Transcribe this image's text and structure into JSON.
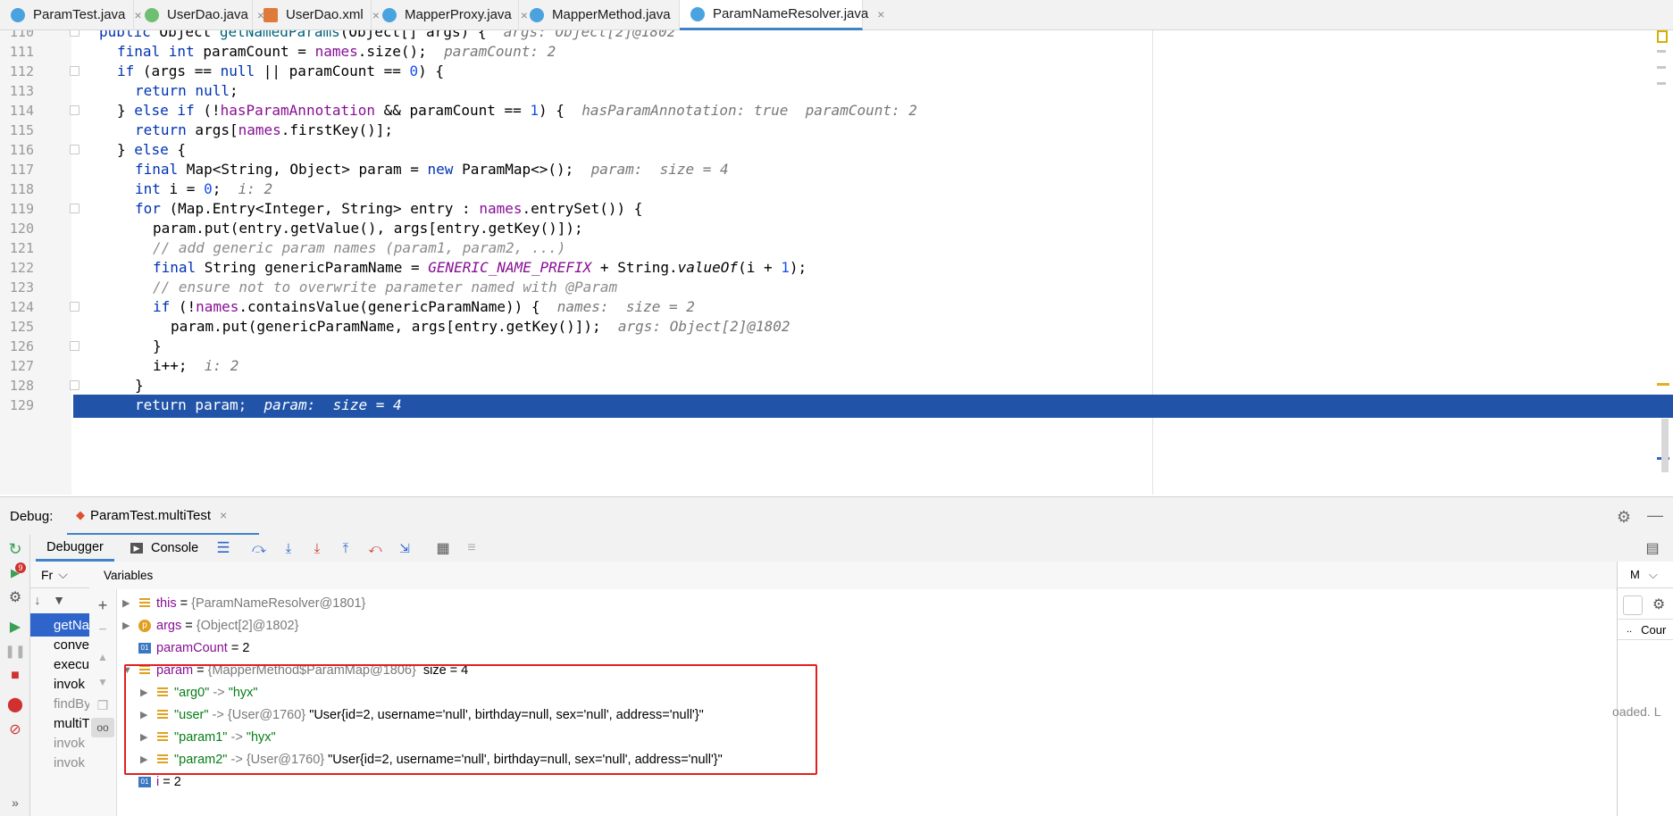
{
  "tabs": [
    {
      "label": "ParamTest.java",
      "icon_color": "#4aa3df",
      "active": false
    },
    {
      "label": "UserDao.java",
      "icon_color": "#6fbf73",
      "active": false
    },
    {
      "label": "UserDao.xml",
      "icon_color": "#e07a3a",
      "active": false
    },
    {
      "label": "MapperProxy.java",
      "icon_color": "#4aa3df",
      "active": false
    },
    {
      "label": "MapperMethod.java",
      "icon_color": "#4aa3df",
      "active": false
    },
    {
      "label": "ParamNameResolver.java",
      "icon_color": "#4aa3df",
      "active": true
    }
  ],
  "editor": {
    "lines": [
      {
        "n": "110"
      },
      {
        "n": "111"
      },
      {
        "n": "112"
      },
      {
        "n": "113"
      },
      {
        "n": "114"
      },
      {
        "n": "115"
      },
      {
        "n": "116"
      },
      {
        "n": "117"
      },
      {
        "n": "118"
      },
      {
        "n": "119"
      },
      {
        "n": "120"
      },
      {
        "n": "121"
      },
      {
        "n": "122"
      },
      {
        "n": "123"
      },
      {
        "n": "124"
      },
      {
        "n": "125"
      },
      {
        "n": "126"
      },
      {
        "n": "127"
      },
      {
        "n": "128"
      },
      {
        "n": "129"
      }
    ],
    "code": {
      "l110": {
        "kw1": "public",
        "t1": " Object ",
        "fn": "getNamedParams",
        "t2": "(Object[] args) {",
        "hint": "args: Object[2]@1802"
      },
      "l111": {
        "kw1": "final int",
        "t1": " paramCount = ",
        "fld": "names",
        "t2": ".size();",
        "hint": "paramCount: 2"
      },
      "l112": {
        "kw1": "if",
        "t1": " (args == ",
        "kw2": "null",
        "t2": " || paramCount == ",
        "num": "0",
        "t3": ") {"
      },
      "l113": {
        "kw1": "return null",
        "t1": ";"
      },
      "l114": {
        "t0": "} ",
        "kw1": "else if",
        "t1": " (!",
        "fld": "hasParamAnnotation",
        "t2": " && paramCount == ",
        "num": "1",
        "t3": ") {",
        "hint": "hasParamAnnotation: true  paramCount: 2"
      },
      "l115": {
        "kw1": "return",
        "t1": " args[",
        "fld": "names",
        "t2": ".firstKey()];"
      },
      "l116": {
        "t0": "} ",
        "kw1": "else",
        "t1": " {"
      },
      "l117": {
        "kw1": "final",
        "t1": " Map<String, Object> param = ",
        "kw2": "new",
        "t2": " ParamMap<>();",
        "hint": "param:  size = 4"
      },
      "l118": {
        "kw1": "int",
        "t1": " i = ",
        "num": "0",
        "t2": ";",
        "hint": "i: 2"
      },
      "l119": {
        "kw1": "for",
        "t1": " (Map.Entry<Integer, String> entry : ",
        "fld": "names",
        "t2": ".entrySet()) {"
      },
      "l120": {
        "t1": "param.put(entry.getValue(), args[entry.getKey()]);"
      },
      "l121": {
        "cmt": "// add generic param names (param1, param2, ...)"
      },
      "l122": {
        "kw1": "final",
        "t1": " String genericParamName = ",
        "cst": "GENERIC_NAME_PREFIX",
        "t2": " + String.",
        "st": "valueOf",
        "t3": "(i + ",
        "num": "1",
        "t4": ");"
      },
      "l123": {
        "cmt": "// ensure not to overwrite parameter named with @Param"
      },
      "l124": {
        "kw1": "if",
        "t1": " (!",
        "fld": "names",
        "t2": ".containsValue(genericParamName)) {",
        "hint": "names:  size = 2"
      },
      "l125": {
        "t1": "param.put(genericParamName, args[entry.getKey()]);",
        "hint": "args: Object[2]@1802"
      },
      "l126": {
        "t1": "}"
      },
      "l127": {
        "t1": "i++;",
        "hint": "i: 2"
      },
      "l128": {
        "t1": "}"
      },
      "l129": {
        "kw1": "return",
        "t1": " param;",
        "hint": "param:  size = 4"
      }
    }
  },
  "debug": {
    "label": "Debug:",
    "session": "ParamTest.multiTest",
    "tab_debugger": "Debugger",
    "tab_console": "Console",
    "frames_header": "Fr",
    "variables_header": "Variables",
    "right_header": "M",
    "right_count": "Cour",
    "right_dots": "..",
    "loaded_text": "oaded. L",
    "badge": "9",
    "frames": [
      {
        "label": "getNa",
        "state": "selected"
      },
      {
        "label": "conve",
        "state": "normal"
      },
      {
        "label": "execu",
        "state": "normal"
      },
      {
        "label": "invok",
        "state": "normal"
      },
      {
        "label": "findBy",
        "state": "gray"
      },
      {
        "label": "multiT",
        "state": "normal"
      },
      {
        "label": "invok",
        "state": "gray"
      },
      {
        "label": "invok",
        "state": "gray"
      }
    ],
    "variables": [
      {
        "name": "this",
        "eq": " = ",
        "ref": "{ParamNameResolver@1801}",
        "icon": "stack",
        "expander": "▶"
      },
      {
        "name": "args",
        "eq": " = ",
        "ref": "{Object[2]@1802}",
        "icon": "p",
        "expander": "▶"
      },
      {
        "name": "paramCount",
        "eq": " = 2",
        "icon": "01"
      },
      {
        "name": "param",
        "eq": " = ",
        "ref": "{MapperMethod$ParamMap@1806}",
        "extra": "  size = 4",
        "icon": "stack",
        "expander": "▼"
      },
      {
        "name": "\"arg0\"",
        "eq": " -> ",
        "str": "\"hyx\"",
        "icon": "stack",
        "expander": "▶",
        "child": true
      },
      {
        "name": "\"user\"",
        "eq": " -> ",
        "ref": "{User@1760} ",
        "val": "\"User{id=2, username='null', birthday=null, sex='null', address='null'}\"",
        "icon": "stack",
        "expander": "▶",
        "child": true
      },
      {
        "name": "\"param1\"",
        "eq": " -> ",
        "str": "\"hyx\"",
        "icon": "stack",
        "expander": "▶",
        "child": true
      },
      {
        "name": "\"param2\"",
        "eq": " -> ",
        "ref": "{User@1760} ",
        "val": "\"User{id=2, username='null', birthday=null, sex='null', address='null'}\"",
        "icon": "stack",
        "expander": "▶",
        "child": true
      },
      {
        "name": "i",
        "eq": " = 2",
        "icon": "01"
      }
    ]
  },
  "colors": {
    "accent": "#2154a8",
    "highlight_box": "#e0201f",
    "selected_frame": "#2f65ca"
  }
}
